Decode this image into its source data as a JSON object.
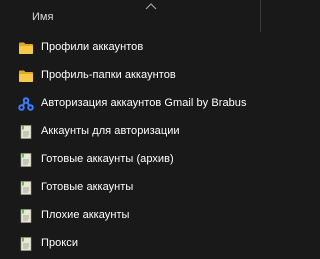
{
  "header": {
    "column_name": "Имя"
  },
  "items": [
    {
      "label": "Профили аккаунтов",
      "icon": "folder-icon"
    },
    {
      "label": "Профиль-папки аккаунтов",
      "icon": "folder-icon"
    },
    {
      "label": "Авторизация аккаунтов Gmail by Brabus",
      "icon": "app-shortcut-icon"
    },
    {
      "label": "Аккаунты для авторизации",
      "icon": "text-file-icon"
    },
    {
      "label": "Готовые аккаунты (архив)",
      "icon": "text-file-icon"
    },
    {
      "label": "Готовые аккаунты",
      "icon": "text-file-icon"
    },
    {
      "label": "Плохие аккаунты",
      "icon": "text-file-icon"
    },
    {
      "label": "Прокси",
      "icon": "text-file-icon"
    }
  ],
  "colors": {
    "background": "#191919",
    "folder": "#F2C94C",
    "app_icon": "#3B7BFF",
    "text_file_bg": "#E8E8D8",
    "text_file_accent": "#6DBF4B"
  }
}
